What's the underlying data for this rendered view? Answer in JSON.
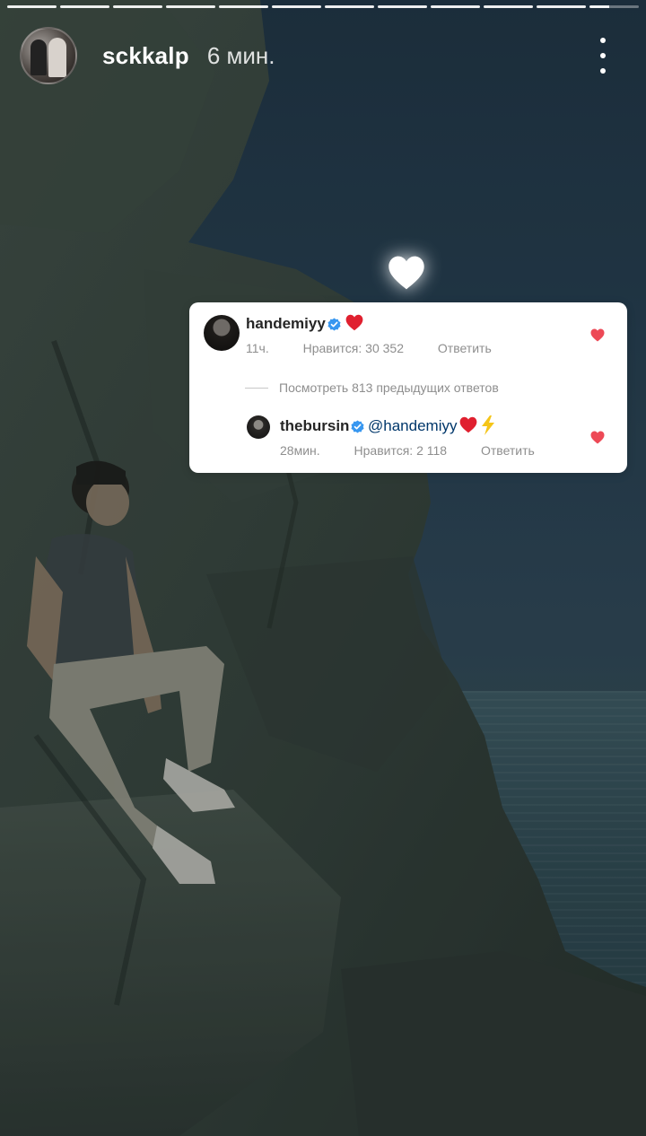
{
  "story": {
    "segments_total": 12,
    "active_segment": 12,
    "username": "sckkalp",
    "time_ago": "6 мин.",
    "more_icon": "more-vertical-icon"
  },
  "comments": {
    "top": {
      "username": "handemiyy",
      "verified": true,
      "emoji": "heart-red-icon",
      "time": "11ч.",
      "likes_label": "Нравится: 30 352",
      "reply_label": "Ответить",
      "liked": true
    },
    "view_previous_label": "Посмотреть 813 предыдущих ответов",
    "reply": {
      "username": "thebursin",
      "verified": true,
      "mention": "@handemiyy",
      "emoji": [
        "heart-red-icon",
        "lightning-icon"
      ],
      "time": "28мин.",
      "likes_label": "Нравится: 2 118",
      "reply_label": "Ответить",
      "liked": true
    }
  },
  "colors": {
    "heart_red": "#ed4956",
    "verified_blue": "#3897f0",
    "mention_blue": "#00376b",
    "meta_gray": "#8e8e8e"
  }
}
